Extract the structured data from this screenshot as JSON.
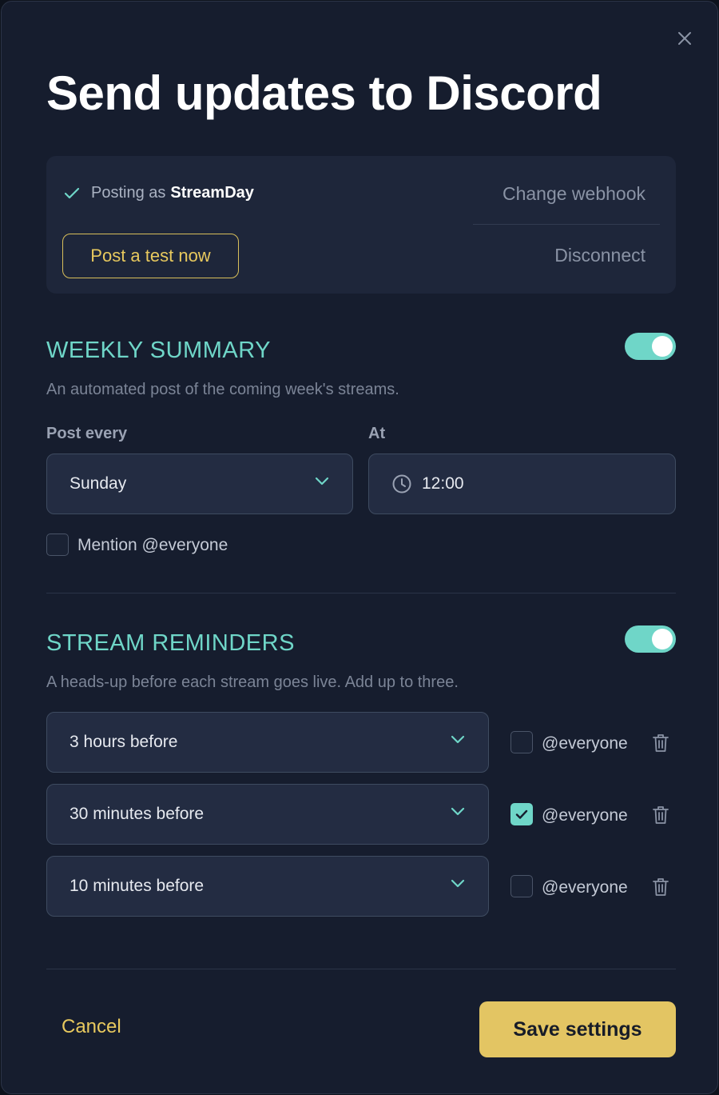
{
  "dialog": {
    "title": "Send updates to Discord",
    "close_icon": "close-icon"
  },
  "webhook": {
    "posting_prefix": "Posting as",
    "posting_name": "StreamDay",
    "test_button": "Post a test now",
    "change_link": "Change webhook",
    "disconnect_link": "Disconnect"
  },
  "weekly": {
    "title": "WEEKLY SUMMARY",
    "enabled": true,
    "description": "An automated post of the coming week's streams.",
    "day_label": "Post every",
    "day_value": "Sunday",
    "time_label": "At",
    "time_value": "12:00",
    "mention_label": "Mention @everyone",
    "mention_checked": false
  },
  "reminders": {
    "title": "STREAM REMINDERS",
    "enabled": true,
    "description": "A heads-up before each stream goes live. Add up to three.",
    "items": [
      {
        "when": "3 hours before",
        "mention": "@everyone",
        "checked": false
      },
      {
        "when": "30 minutes before",
        "mention": "@everyone",
        "checked": true
      },
      {
        "when": "10 minutes before",
        "mention": "@everyone",
        "checked": false
      }
    ]
  },
  "footer": {
    "cancel": "Cancel",
    "save": "Save settings"
  },
  "colors": {
    "accent_teal": "#6fd6c8",
    "accent_gold": "#e3c563",
    "background": "#161d2e"
  }
}
